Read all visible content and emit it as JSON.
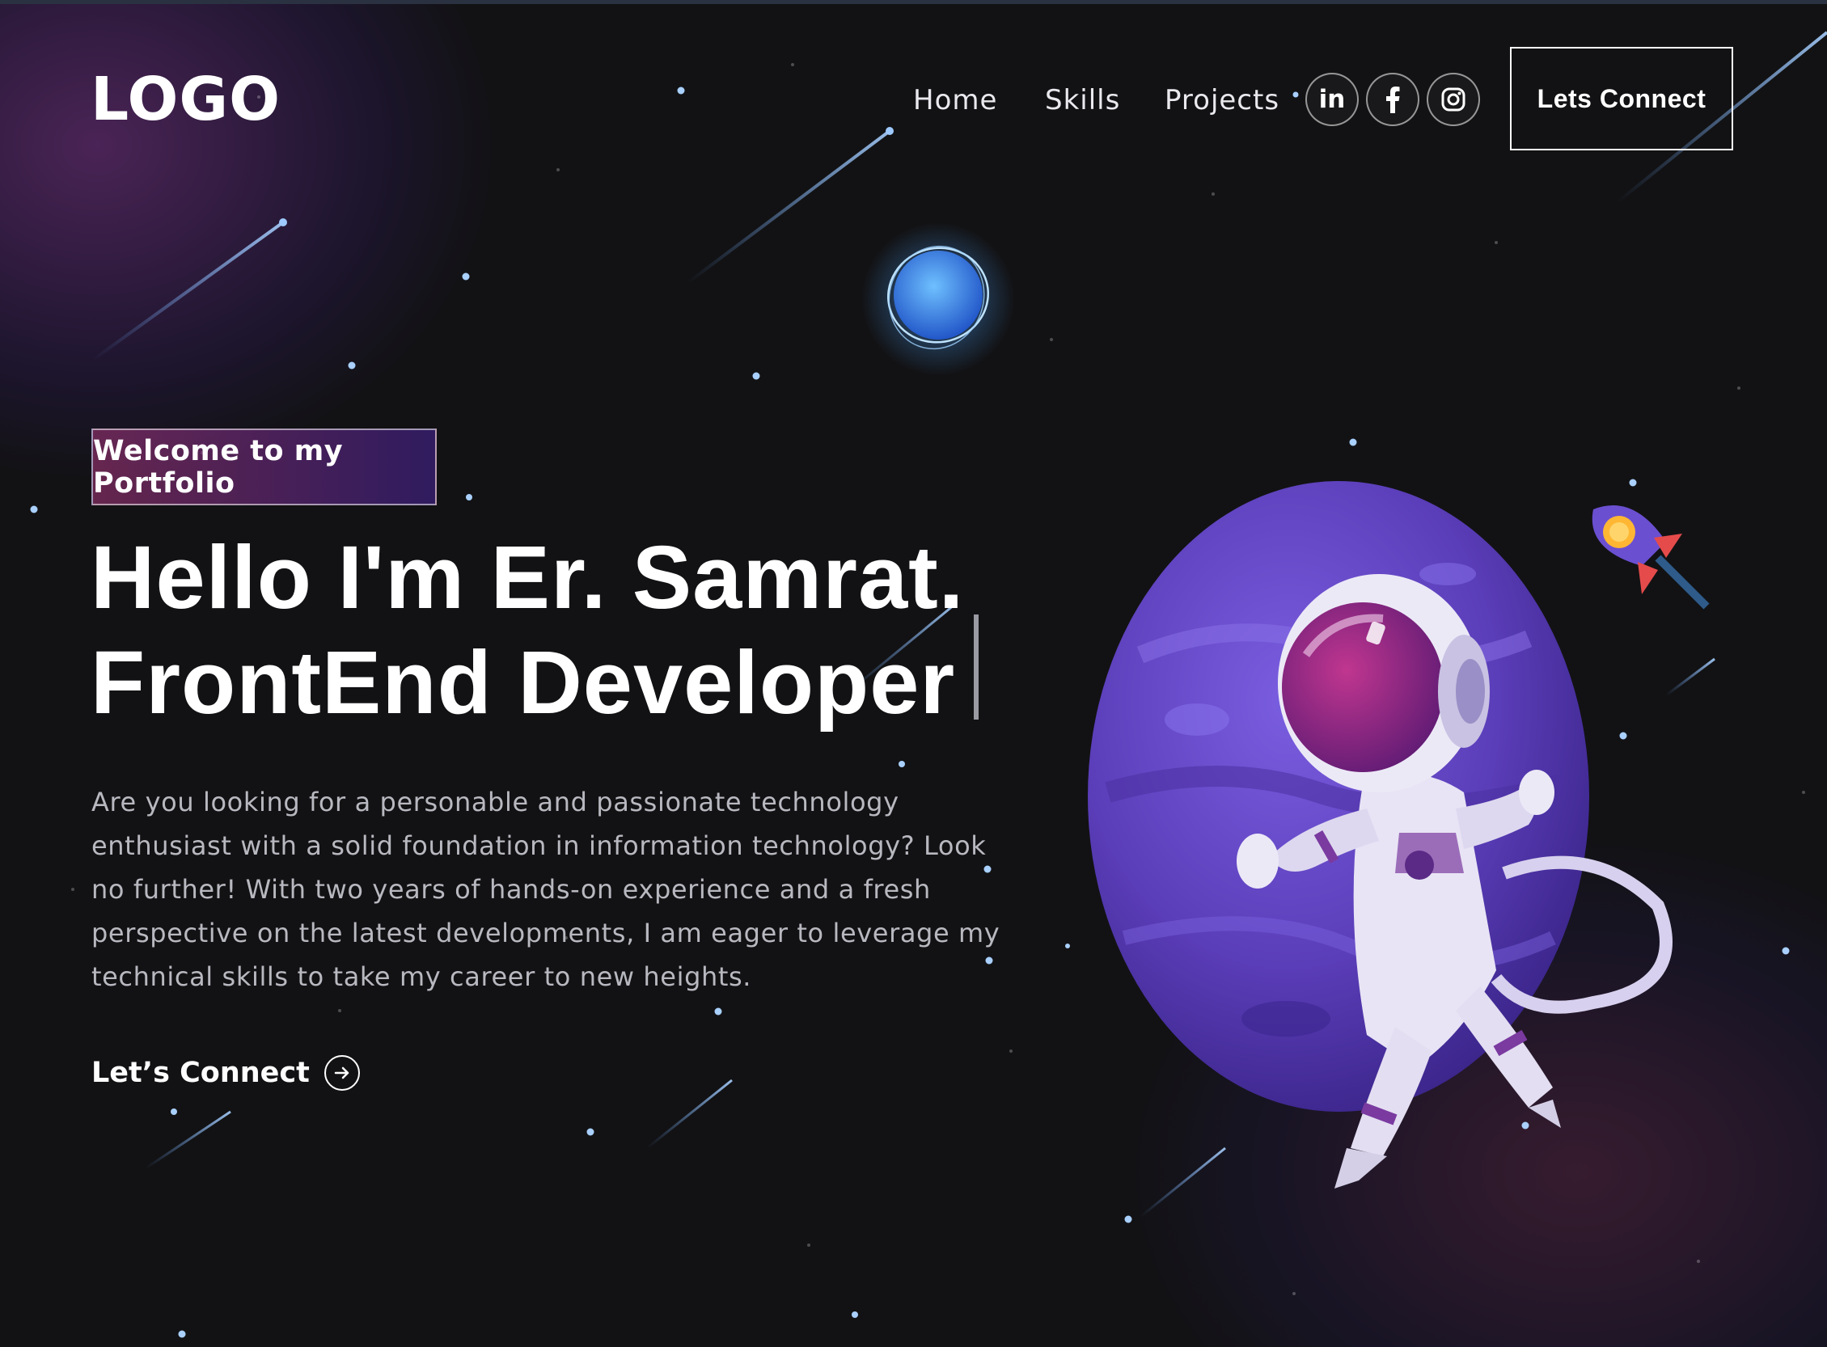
{
  "nav": {
    "logo": "LOGO",
    "links": [
      "Home",
      "Skills",
      "Projects"
    ],
    "socials": {
      "linkedin": {
        "icon": "linkedin-icon",
        "label": "in"
      },
      "facebook": {
        "icon": "facebook-icon"
      },
      "instagram": {
        "icon": "instagram-icon"
      }
    },
    "connect_button": "Lets Connect"
  },
  "hero": {
    "badge": "Welcome to my Portfolio",
    "headline_line1": "Hello I'm Er. Samrat.",
    "headline_line2": "FrontEnd Developer",
    "paragraph": "Are you looking for a personable and passionate technology enthusiast with a solid foundation in information technology? Look no further! With two years of hands-on experience and a fresh perspective on the latest developments, I am eager to leverage my technical skills to take my career to new heights.",
    "cta": "Let’s Connect",
    "cta_icon": "arrow-right-circle-icon"
  },
  "colors": {
    "background": "#121214",
    "badge_gradient_start": "#aa367c",
    "badge_gradient_end": "#4a2fbd",
    "planet": "#5b3bb5",
    "text_muted": "#b8b8c0"
  }
}
